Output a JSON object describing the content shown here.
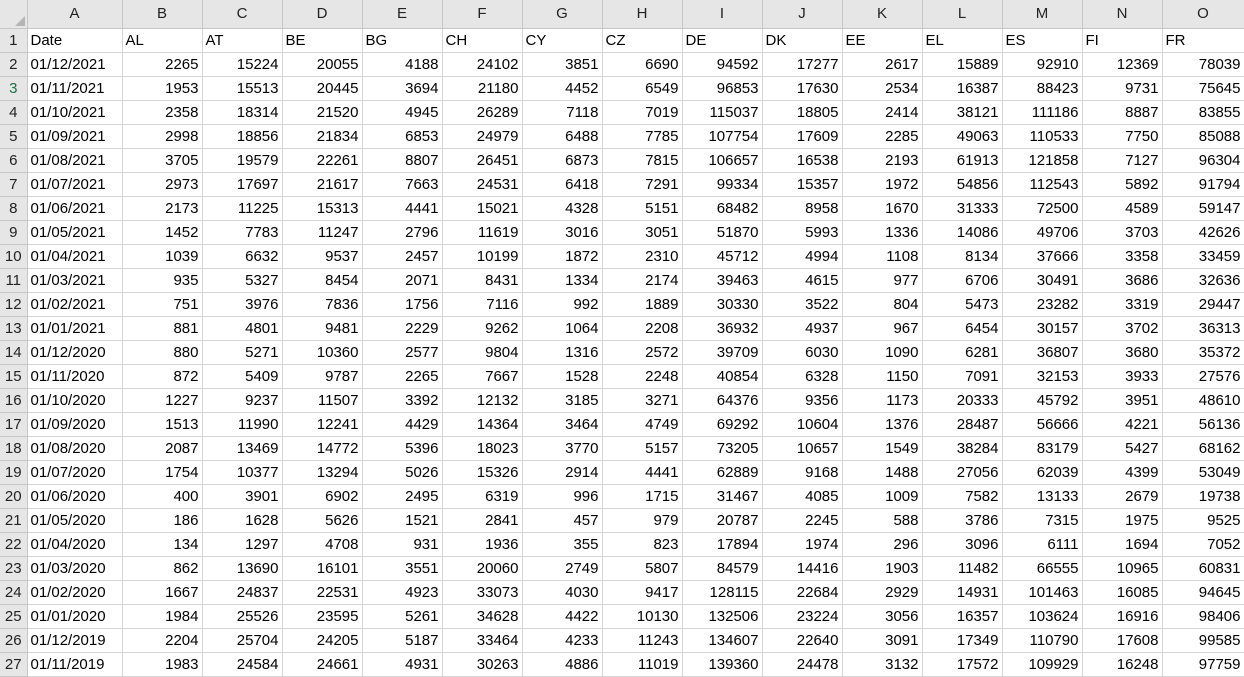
{
  "columns": [
    "A",
    "B",
    "C",
    "D",
    "E",
    "F",
    "G",
    "H",
    "I",
    "J",
    "K",
    "L",
    "M",
    "N",
    "O"
  ],
  "header_row": [
    "Date",
    "AL",
    "AT",
    "BE",
    "BG",
    "CH",
    "CY",
    "CZ",
    "DE",
    "DK",
    "EE",
    "EL",
    "ES",
    "FI",
    "FR"
  ],
  "rows": [
    [
      "01/12/2021",
      2265,
      15224,
      20055,
      4188,
      24102,
      3851,
      6690,
      94592,
      17277,
      2617,
      15889,
      92910,
      12369,
      78039
    ],
    [
      "01/11/2021",
      1953,
      15513,
      20445,
      3694,
      21180,
      4452,
      6549,
      96853,
      17630,
      2534,
      16387,
      88423,
      9731,
      75645
    ],
    [
      "01/10/2021",
      2358,
      18314,
      21520,
      4945,
      26289,
      7118,
      7019,
      115037,
      18805,
      2414,
      38121,
      111186,
      8887,
      83855
    ],
    [
      "01/09/2021",
      2998,
      18856,
      21834,
      6853,
      24979,
      6488,
      7785,
      107754,
      17609,
      2285,
      49063,
      110533,
      7750,
      85088
    ],
    [
      "01/08/2021",
      3705,
      19579,
      22261,
      8807,
      26451,
      6873,
      7815,
      106657,
      16538,
      2193,
      61913,
      121858,
      7127,
      96304
    ],
    [
      "01/07/2021",
      2973,
      17697,
      21617,
      7663,
      24531,
      6418,
      7291,
      99334,
      15357,
      1972,
      54856,
      112543,
      5892,
      91794
    ],
    [
      "01/06/2021",
      2173,
      11225,
      15313,
      4441,
      15021,
      4328,
      5151,
      68482,
      8958,
      1670,
      31333,
      72500,
      4589,
      59147
    ],
    [
      "01/05/2021",
      1452,
      7783,
      11247,
      2796,
      11619,
      3016,
      3051,
      51870,
      5993,
      1336,
      14086,
      49706,
      3703,
      42626
    ],
    [
      "01/04/2021",
      1039,
      6632,
      9537,
      2457,
      10199,
      1872,
      2310,
      45712,
      4994,
      1108,
      8134,
      37666,
      3358,
      33459
    ],
    [
      "01/03/2021",
      935,
      5327,
      8454,
      2071,
      8431,
      1334,
      2174,
      39463,
      4615,
      977,
      6706,
      30491,
      3686,
      32636
    ],
    [
      "01/02/2021",
      751,
      3976,
      7836,
      1756,
      7116,
      992,
      1889,
      30330,
      3522,
      804,
      5473,
      23282,
      3319,
      29447
    ],
    [
      "01/01/2021",
      881,
      4801,
      9481,
      2229,
      9262,
      1064,
      2208,
      36932,
      4937,
      967,
      6454,
      30157,
      3702,
      36313
    ],
    [
      "01/12/2020",
      880,
      5271,
      10360,
      2577,
      9804,
      1316,
      2572,
      39709,
      6030,
      1090,
      6281,
      36807,
      3680,
      35372
    ],
    [
      "01/11/2020",
      872,
      5409,
      9787,
      2265,
      7667,
      1528,
      2248,
      40854,
      6328,
      1150,
      7091,
      32153,
      3933,
      27576
    ],
    [
      "01/10/2020",
      1227,
      9237,
      11507,
      3392,
      12132,
      3185,
      3271,
      64376,
      9356,
      1173,
      20333,
      45792,
      3951,
      48610
    ],
    [
      "01/09/2020",
      1513,
      11990,
      12241,
      4429,
      14364,
      3464,
      4749,
      69292,
      10604,
      1376,
      28487,
      56666,
      4221,
      56136
    ],
    [
      "01/08/2020",
      2087,
      13469,
      14772,
      5396,
      18023,
      3770,
      5157,
      73205,
      10657,
      1549,
      38284,
      83179,
      5427,
      68162
    ],
    [
      "01/07/2020",
      1754,
      10377,
      13294,
      5026,
      15326,
      2914,
      4441,
      62889,
      9168,
      1488,
      27056,
      62039,
      4399,
      53049
    ],
    [
      "01/06/2020",
      400,
      3901,
      6902,
      2495,
      6319,
      996,
      1715,
      31467,
      4085,
      1009,
      7582,
      13133,
      2679,
      19738
    ],
    [
      "01/05/2020",
      186,
      1628,
      5626,
      1521,
      2841,
      457,
      979,
      20787,
      2245,
      588,
      3786,
      7315,
      1975,
      9525
    ],
    [
      "01/04/2020",
      134,
      1297,
      4708,
      931,
      1936,
      355,
      823,
      17894,
      1974,
      296,
      3096,
      6111,
      1694,
      7052
    ],
    [
      "01/03/2020",
      862,
      13690,
      16101,
      3551,
      20060,
      2749,
      5807,
      84579,
      14416,
      1903,
      11482,
      66555,
      10965,
      60831
    ],
    [
      "01/02/2020",
      1667,
      24837,
      22531,
      4923,
      33073,
      4030,
      9417,
      128115,
      22684,
      2929,
      14931,
      101463,
      16085,
      94645
    ],
    [
      "01/01/2020",
      1984,
      25526,
      23595,
      5261,
      34628,
      4422,
      10130,
      132506,
      23224,
      3056,
      16357,
      103624,
      16916,
      98406
    ],
    [
      "01/12/2019",
      2204,
      25704,
      24205,
      5187,
      33464,
      4233,
      11243,
      134607,
      22640,
      3091,
      17349,
      110790,
      17608,
      99585
    ],
    [
      "01/11/2019",
      1983,
      24584,
      24661,
      4931,
      30263,
      4886,
      11019,
      139360,
      24478,
      3132,
      17572,
      109929,
      16248,
      97759
    ]
  ],
  "active_row": 3,
  "active_column": "A",
  "colors": {
    "grid": "#d4d4d4",
    "header_bg": "#e6e6e6",
    "selection": "#217346"
  }
}
